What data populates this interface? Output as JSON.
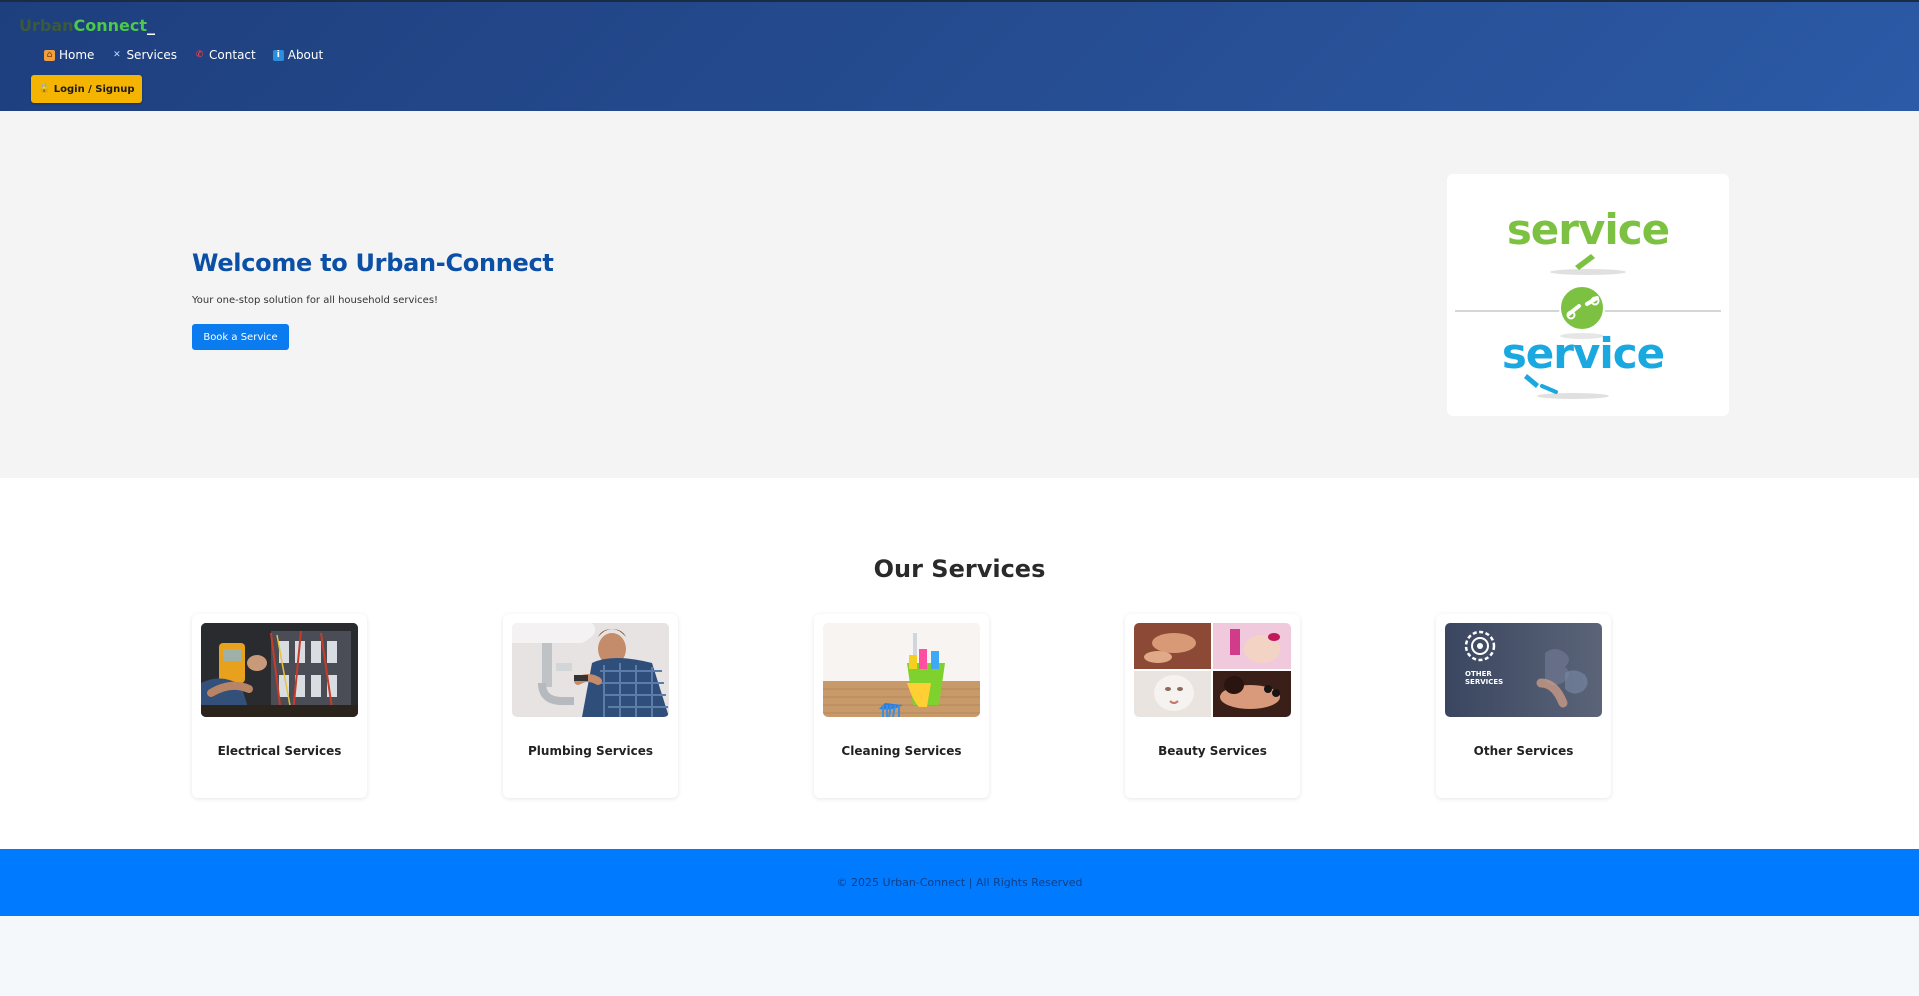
{
  "brand": {
    "part1": "Urban",
    "part2": "Connect",
    "cursor": "_"
  },
  "nav": {
    "items": [
      {
        "label": "Home",
        "icon": "home-icon"
      },
      {
        "label": "Services",
        "icon": "tools-icon"
      },
      {
        "label": "Contact",
        "icon": "phone-icon"
      },
      {
        "label": "About",
        "icon": "info-icon"
      }
    ],
    "login_label": "Login / Signup"
  },
  "hero": {
    "title": "Welcome to Urban-Connect",
    "subtitle": "Your one-stop solution for all household services!",
    "cta_label": "Book a Service",
    "image_words": [
      "service",
      "service"
    ],
    "colors": {
      "title": "#0b4fa6",
      "cta": "#0b7bf0",
      "logo_green": "#7cc142",
      "logo_blue": "#19a8e0"
    }
  },
  "services": {
    "title": "Our Services",
    "cards": [
      {
        "label": "Electrical Services"
      },
      {
        "label": "Plumbing Services"
      },
      {
        "label": "Cleaning Services"
      },
      {
        "label": "Beauty Services"
      },
      {
        "label": "Other Services",
        "image_text": [
          "OTHER",
          "SERVICES"
        ]
      }
    ]
  },
  "footer": {
    "text": "© 2025 Urban-Connect | All Rights Reserved"
  },
  "colors": {
    "header": "#264d92",
    "accent": "#f4b400",
    "footer": "#007bff"
  }
}
